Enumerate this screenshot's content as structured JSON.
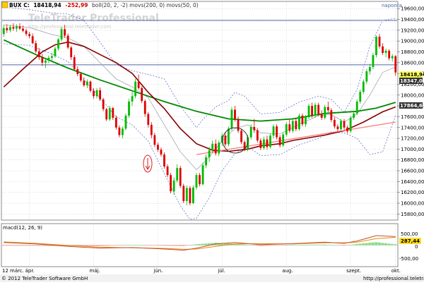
{
  "colors": {
    "candle_up": "#00bb00",
    "candle_down": "#dd0000",
    "boll": "#6677cc",
    "mov200": "#008800",
    "mov50": "#880000",
    "trendline": "#ff7777",
    "hline": "#5566aa",
    "grid": "#c8c8c8",
    "frame": "#888888",
    "macd_line": "#bb5533",
    "signal_line": "#ee8800",
    "hist_pos": "#88dd88",
    "hist_neg": "#ff9999",
    "last_price_bg": "#ffff55",
    "tag_bg": "#333333",
    "macd_tag_bg": "#ffdd22"
  },
  "header": {
    "symbol": "BUX C:",
    "last": "18418,94",
    "change": "-252,99",
    "indicators": "boll(20, 2, -2) movs(200, 0) movs(50, 0)",
    "timeframe": "naponta"
  },
  "watermark": {
    "title": "TeleTrader Professional",
    "url": "http://professional.teletrader.com"
  },
  "price_axis": {
    "ticks": [
      "19600,00",
      "19400,00",
      "19200,00",
      "19000,00",
      "18800,00",
      "18600,00",
      "18400,00",
      "18200,00",
      "18000,00",
      "17800,00",
      "17600,00",
      "17400,00",
      "17200,00",
      "17000,00",
      "16800,00",
      "16600,00",
      "16400,00",
      "16200,00",
      "16000,00",
      "15800,00"
    ],
    "last_tag": "18418,94",
    "tag2": "18347,00",
    "tag3": "17864,68"
  },
  "macd": {
    "label": "macd(12, 26, 9)",
    "ticks": [
      "500,00",
      "0",
      "-500,00"
    ],
    "tag": "287,44"
  },
  "time_axis": {
    "year": "12",
    "months": [
      "márc.",
      "ápr.",
      "máj.",
      "jún.",
      "júl.",
      "aug.",
      "szept.",
      "okt."
    ]
  },
  "footer": {
    "copyright": "© 2012 TeleTrader Software GmbH",
    "url": "http://professional.teletrader.com"
  },
  "chart_data": {
    "type": "candlestick",
    "symbol": "BUX C:",
    "ylim": [
      15700,
      19720
    ],
    "x_axis": "trading days, 12 márc. – okt.",
    "ohlc": [
      [
        19130,
        19300,
        19080,
        19240
      ],
      [
        19240,
        19310,
        19150,
        19200
      ],
      [
        19200,
        19300,
        19160,
        19260
      ],
      [
        19260,
        19330,
        19190,
        19230
      ],
      [
        19230,
        19310,
        19170,
        19270
      ],
      [
        19270,
        19330,
        19210,
        19230
      ],
      [
        19230,
        19290,
        19160,
        19190
      ],
      [
        19190,
        19230,
        19090,
        19130
      ],
      [
        19130,
        19170,
        19050,
        19090
      ],
      [
        19090,
        19140,
        18940,
        18960
      ],
      [
        18960,
        19010,
        18780,
        18810
      ],
      [
        18810,
        18870,
        18650,
        18700
      ],
      [
        18700,
        18760,
        18540,
        18600
      ],
      [
        18600,
        18680,
        18500,
        18640
      ],
      [
        18640,
        18730,
        18590,
        18690
      ],
      [
        18690,
        18780,
        18640,
        18720
      ],
      [
        18720,
        18900,
        18690,
        18860
      ],
      [
        18860,
        19060,
        18820,
        19030
      ],
      [
        19030,
        19260,
        18990,
        19220
      ],
      [
        19220,
        19300,
        19060,
        19100
      ],
      [
        19100,
        19140,
        18850,
        18880
      ],
      [
        18880,
        18910,
        18650,
        18700
      ],
      [
        18700,
        18740,
        18450,
        18480
      ],
      [
        18480,
        18530,
        18350,
        18390
      ],
      [
        18390,
        18430,
        18240,
        18270
      ],
      [
        18270,
        18330,
        18150,
        18180
      ],
      [
        18180,
        18290,
        18130,
        18250
      ],
      [
        18250,
        18270,
        18050,
        18080
      ],
      [
        18080,
        18130,
        17930,
        17980
      ],
      [
        17980,
        18130,
        17940,
        18090
      ],
      [
        18090,
        18140,
        17890,
        17920
      ],
      [
        17920,
        17950,
        17700,
        17740
      ],
      [
        17740,
        17760,
        17520,
        17550
      ],
      [
        17550,
        17800,
        17520,
        17760
      ],
      [
        17760,
        17780,
        17540,
        17580
      ],
      [
        17580,
        17620,
        17360,
        17400
      ],
      [
        17400,
        17440,
        17220,
        17260
      ],
      [
        17260,
        17420,
        17200,
        17380
      ],
      [
        17380,
        17660,
        17350,
        17620
      ],
      [
        17620,
        17930,
        17580,
        17880
      ],
      [
        17880,
        18060,
        17800,
        17980
      ],
      [
        17980,
        18300,
        17940,
        18250
      ],
      [
        18250,
        18380,
        18100,
        18130
      ],
      [
        18130,
        18160,
        17850,
        17890
      ],
      [
        17890,
        17920,
        17600,
        17650
      ],
      [
        17650,
        17690,
        17400,
        17450
      ],
      [
        17450,
        17500,
        17200,
        17260
      ],
      [
        17260,
        17300,
        17040,
        17080
      ],
      [
        17080,
        17120,
        16950,
        16990
      ],
      [
        16990,
        17030,
        16860,
        16900
      ],
      [
        16900,
        16940,
        16640,
        16680
      ],
      [
        16680,
        16720,
        16480,
        16520
      ],
      [
        16520,
        16560,
        16180,
        16220
      ],
      [
        16220,
        16480,
        16160,
        16420
      ],
      [
        16420,
        16720,
        16380,
        16650
      ],
      [
        16650,
        16690,
        16280,
        16320
      ],
      [
        16320,
        16360,
        16000,
        16040
      ],
      [
        16040,
        16330,
        15960,
        16280
      ],
      [
        16280,
        16320,
        15960,
        16000
      ],
      [
        16000,
        16330,
        15980,
        16290
      ],
      [
        16290,
        16560,
        16250,
        16520
      ],
      [
        16520,
        16560,
        16310,
        16350
      ],
      [
        16350,
        16750,
        16330,
        16700
      ],
      [
        16700,
        16900,
        16650,
        16850
      ],
      [
        16850,
        17040,
        16760,
        16980
      ],
      [
        16980,
        17160,
        16930,
        17100
      ],
      [
        17100,
        17180,
        16880,
        16920
      ],
      [
        16920,
        17160,
        16870,
        17120
      ],
      [
        17120,
        17300,
        17060,
        17250
      ],
      [
        17250,
        17320,
        17050,
        17090
      ],
      [
        17090,
        17420,
        17050,
        17380
      ],
      [
        17380,
        17780,
        17340,
        17730
      ],
      [
        17730,
        17800,
        17510,
        17560
      ],
      [
        17560,
        17600,
        17300,
        17340
      ],
      [
        17340,
        17380,
        17090,
        17130
      ],
      [
        17130,
        17160,
        16960,
        17000
      ],
      [
        17000,
        17260,
        16960,
        17220
      ],
      [
        17220,
        17460,
        17180,
        17410
      ],
      [
        17410,
        17560,
        17300,
        17350
      ],
      [
        17350,
        17390,
        17120,
        17160
      ],
      [
        17160,
        17200,
        16980,
        17020
      ],
      [
        17020,
        17230,
        16990,
        17180
      ],
      [
        17180,
        17250,
        16990,
        17040
      ],
      [
        17040,
        17290,
        17010,
        17250
      ],
      [
        17250,
        17460,
        17200,
        17420
      ],
      [
        17420,
        17460,
        17180,
        17220
      ],
      [
        17220,
        17260,
        17030,
        17070
      ],
      [
        17070,
        17310,
        17040,
        17270
      ],
      [
        17270,
        17500,
        17230,
        17460
      ],
      [
        17460,
        17540,
        17300,
        17340
      ],
      [
        17340,
        17560,
        17300,
        17520
      ],
      [
        17520,
        17580,
        17330,
        17370
      ],
      [
        17370,
        17660,
        17340,
        17620
      ],
      [
        17620,
        17660,
        17420,
        17460
      ],
      [
        17460,
        17630,
        17410,
        17590
      ],
      [
        17590,
        17840,
        17560,
        17800
      ],
      [
        17800,
        17860,
        17580,
        17620
      ],
      [
        17620,
        17860,
        17580,
        17820
      ],
      [
        17820,
        17860,
        17610,
        17650
      ],
      [
        17650,
        17720,
        17540,
        17580
      ],
      [
        17580,
        17820,
        17550,
        17780
      ],
      [
        17780,
        17880,
        17680,
        17720
      ],
      [
        17720,
        17760,
        17500,
        17540
      ],
      [
        17540,
        17590,
        17380,
        17420
      ],
      [
        17420,
        17460,
        17330,
        17370
      ],
      [
        17370,
        17560,
        17340,
        17520
      ],
      [
        17520,
        17560,
        17360,
        17400
      ],
      [
        17400,
        17440,
        17290,
        17330
      ],
      [
        17330,
        17620,
        17300,
        17580
      ],
      [
        17580,
        17700,
        17540,
        17660
      ],
      [
        17660,
        17920,
        17630,
        17880
      ],
      [
        17880,
        18100,
        17840,
        18060
      ],
      [
        18060,
        18290,
        18020,
        18250
      ],
      [
        18250,
        18480,
        18210,
        18440
      ],
      [
        18440,
        18580,
        18380,
        18520
      ],
      [
        18520,
        18780,
        18480,
        18740
      ],
      [
        18740,
        19100,
        18700,
        19080
      ],
      [
        19080,
        19130,
        18860,
        18900
      ],
      [
        18900,
        18960,
        18740,
        18780
      ],
      [
        18780,
        18860,
        18700,
        18820
      ],
      [
        18820,
        18850,
        18640,
        18680
      ],
      [
        18680,
        18760,
        18620,
        18720
      ],
      [
        18720,
        18740,
        18360,
        18418.94
      ]
    ],
    "bollinger": {
      "upper": [
        [
          0,
          19630
        ],
        [
          8,
          19580
        ],
        [
          15,
          19520
        ],
        [
          20,
          19500
        ],
        [
          25,
          19380
        ],
        [
          30,
          18980
        ],
        [
          35,
          18560
        ],
        [
          40,
          18450
        ],
        [
          45,
          18380
        ],
        [
          50,
          18300
        ],
        [
          55,
          17800
        ],
        [
          60,
          17400
        ],
        [
          62,
          17550
        ],
        [
          66,
          17780
        ],
        [
          70,
          17900
        ],
        [
          72,
          18050
        ],
        [
          75,
          17980
        ],
        [
          80,
          17650
        ],
        [
          86,
          17680
        ],
        [
          92,
          17870
        ],
        [
          98,
          17980
        ],
        [
          102,
          17920
        ],
        [
          106,
          17680
        ],
        [
          110,
          18100
        ],
        [
          114,
          18900
        ],
        [
          118,
          19380
        ],
        [
          122,
          19420
        ]
      ],
      "middle": [
        [
          0,
          19300
        ],
        [
          8,
          19250
        ],
        [
          15,
          19120
        ],
        [
          20,
          19060
        ],
        [
          25,
          18900
        ],
        [
          30,
          18600
        ],
        [
          35,
          18300
        ],
        [
          40,
          18150
        ],
        [
          45,
          17950
        ],
        [
          50,
          17450
        ],
        [
          55,
          16950
        ],
        [
          60,
          16620
        ],
        [
          64,
          16850
        ],
        [
          68,
          17150
        ],
        [
          72,
          17380
        ],
        [
          76,
          17450
        ],
        [
          80,
          17300
        ],
        [
          86,
          17280
        ],
        [
          92,
          17460
        ],
        [
          98,
          17620
        ],
        [
          102,
          17640
        ],
        [
          106,
          17500
        ],
        [
          110,
          17650
        ],
        [
          114,
          18000
        ],
        [
          118,
          18420
        ],
        [
          122,
          18520
        ]
      ],
      "lower": [
        [
          0,
          18950
        ],
        [
          8,
          18920
        ],
        [
          15,
          18760
        ],
        [
          20,
          18620
        ],
        [
          25,
          18280
        ],
        [
          30,
          17950
        ],
        [
          35,
          17600
        ],
        [
          40,
          17450
        ],
        [
          45,
          17150
        ],
        [
          50,
          16550
        ],
        [
          55,
          15950
        ],
        [
          58,
          15700
        ],
        [
          60,
          15720
        ],
        [
          64,
          16100
        ],
        [
          68,
          16600
        ],
        [
          72,
          16920
        ],
        [
          76,
          17050
        ],
        [
          80,
          16880
        ],
        [
          86,
          16900
        ],
        [
          92,
          17080
        ],
        [
          98,
          17200
        ],
        [
          102,
          17320
        ],
        [
          106,
          17300
        ],
        [
          110,
          17200
        ],
        [
          114,
          16900
        ],
        [
          118,
          16950
        ],
        [
          122,
          17620
        ]
      ]
    },
    "mov200": [
      [
        0,
        19020
      ],
      [
        10,
        18750
      ],
      [
        20,
        18500
      ],
      [
        30,
        18280
      ],
      [
        40,
        18080
      ],
      [
        50,
        17880
      ],
      [
        60,
        17700
      ],
      [
        70,
        17560
      ],
      [
        80,
        17520
      ],
      [
        90,
        17560
      ],
      [
        100,
        17660
      ],
      [
        110,
        17700
      ],
      [
        116,
        17760
      ],
      [
        122,
        17864.68
      ]
    ],
    "mov50": [
      [
        0,
        18150
      ],
      [
        6,
        18480
      ],
      [
        12,
        18800
      ],
      [
        16,
        18930
      ],
      [
        20,
        18980
      ],
      [
        25,
        18900
      ],
      [
        30,
        18750
      ],
      [
        35,
        18600
      ],
      [
        40,
        18400
      ],
      [
        45,
        18050
      ],
      [
        50,
        17750
      ],
      [
        55,
        17380
      ],
      [
        60,
        17100
      ],
      [
        65,
        16980
      ],
      [
        70,
        16960
      ],
      [
        76,
        17000
      ],
      [
        80,
        17060
      ],
      [
        86,
        17100
      ],
      [
        90,
        17160
      ],
      [
        100,
        17260
      ],
      [
        106,
        17340
      ],
      [
        112,
        17500
      ],
      [
        118,
        17690
      ],
      [
        122,
        17780
      ]
    ],
    "trendline": [
      [
        60,
        16900
      ],
      [
        122,
        17500
      ]
    ],
    "hlines": [
      19380,
      18560
    ]
  },
  "macd_data": {
    "ylim": [
      -700,
      700
    ],
    "macd": [
      [
        0,
        90
      ],
      [
        10,
        40
      ],
      [
        20,
        -40
      ],
      [
        30,
        -100
      ],
      [
        40,
        -80
      ],
      [
        50,
        -130
      ],
      [
        56,
        -170
      ],
      [
        60,
        -100
      ],
      [
        66,
        40
      ],
      [
        72,
        90
      ],
      [
        80,
        20
      ],
      [
        90,
        50
      ],
      [
        100,
        100
      ],
      [
        106,
        60
      ],
      [
        110,
        140
      ],
      [
        116,
        320
      ],
      [
        122,
        287.44
      ]
    ],
    "signal": [
      [
        0,
        110
      ],
      [
        10,
        60
      ],
      [
        20,
        -10
      ],
      [
        30,
        -70
      ],
      [
        40,
        -90
      ],
      [
        50,
        -110
      ],
      [
        56,
        -140
      ],
      [
        60,
        -130
      ],
      [
        66,
        -40
      ],
      [
        72,
        40
      ],
      [
        80,
        50
      ],
      [
        90,
        40
      ],
      [
        100,
        80
      ],
      [
        106,
        80
      ],
      [
        110,
        100
      ],
      [
        116,
        220
      ],
      [
        122,
        260
      ]
    ]
  }
}
